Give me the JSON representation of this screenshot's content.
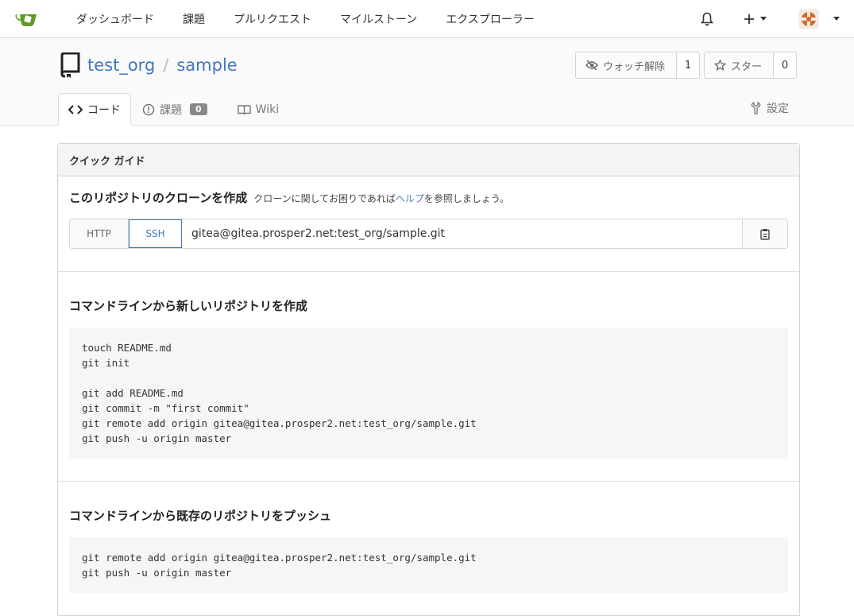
{
  "nav": {
    "items": [
      "ダッシュボード",
      "課題",
      "プルリクエスト",
      "マイルストーン",
      "エクスプローラー"
    ],
    "plus_label": "+",
    "icons": [
      "gitea-logo-icon",
      "bell-icon",
      "plus-icon",
      "avatar-icon"
    ]
  },
  "repo": {
    "owner": "test_org",
    "separator": "/",
    "name": "sample",
    "watch_label": "ウォッチ解除",
    "watch_count": "1",
    "star_label": "スター",
    "star_count": "0"
  },
  "tabs": {
    "code": "コード",
    "issues": "課題",
    "issues_count": "0",
    "wiki": "Wiki",
    "settings": "設定"
  },
  "quick_guide": {
    "header": "クイック ガイド",
    "clone_title": "このリポジトリのクローンを作成",
    "clone_help_prefix": "クローンに関してお困りであれば",
    "clone_help_link": "ヘルプ",
    "clone_help_suffix": "を参照しましょう。",
    "http_label": "HTTP",
    "ssh_label": "SSH",
    "clone_url": "gitea@gitea.prosper2.net:test_org/sample.git",
    "new_repo_title": "コマンドラインから新しいリポジトリを作成",
    "new_repo_code": "touch README.md\ngit init\n\ngit add README.md\ngit commit -m \"first commit\"\ngit remote add origin gitea@gitea.prosper2.net:test_org/sample.git\ngit push -u origin master",
    "push_title": "コマンドラインから既存のリポジトリをプッシュ",
    "push_code": "git remote add origin gitea@gitea.prosper2.net:test_org/sample.git\ngit push -u origin master"
  },
  "colors": {
    "link": "#4078c0",
    "logo": "#609926",
    "avatar": "#c0392b"
  }
}
